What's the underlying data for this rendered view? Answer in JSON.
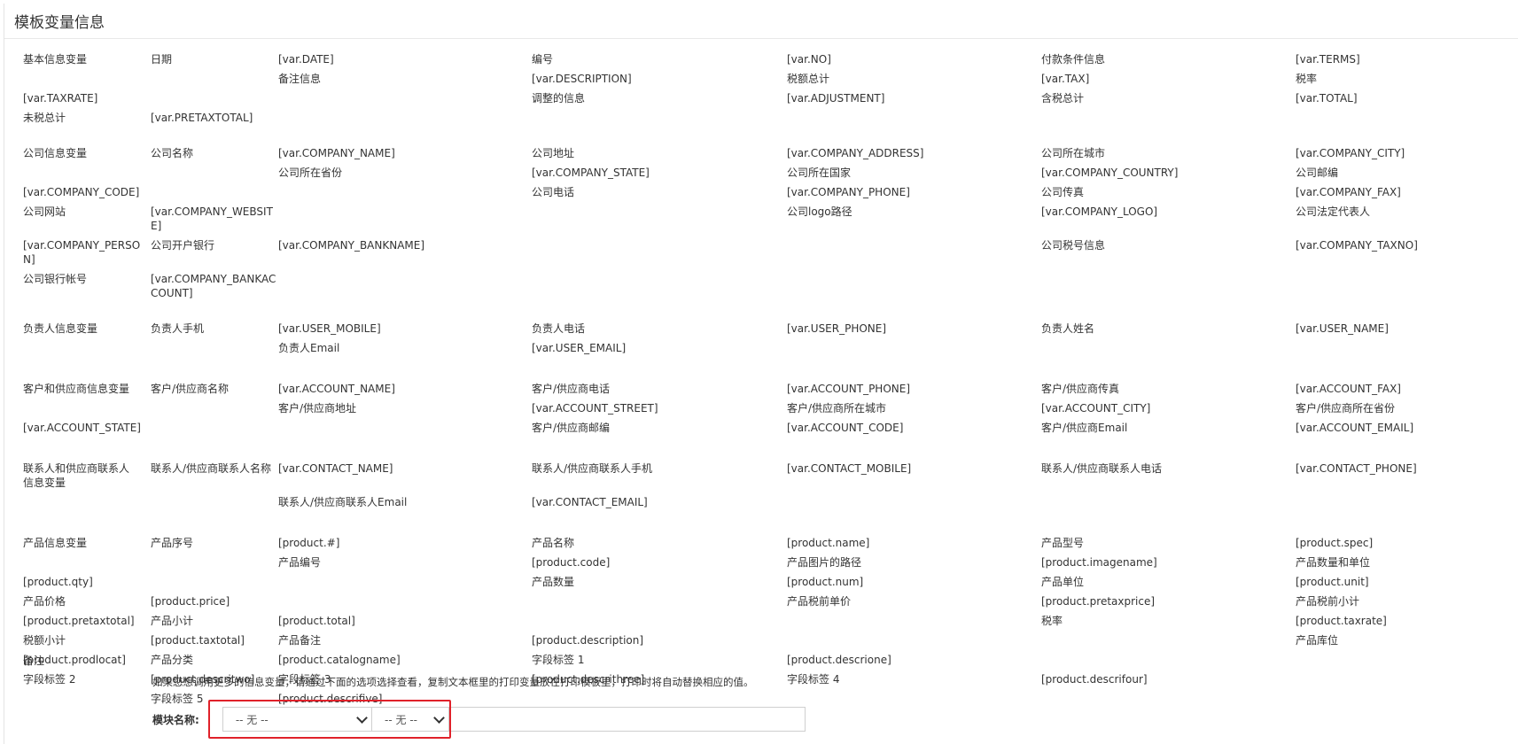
{
  "header": {
    "title": "模板变量信息"
  },
  "groups": [
    {
      "title": "基本信息变量",
      "rows": [
        [
          "日期",
          "[var.DATE]",
          "编号",
          "[var.NO]",
          "付款条件信息",
          "[var.TERMS]"
        ],
        [
          "备注信息",
          "[var.DESCRIPTION]",
          "税额总计",
          "[var.TAX]",
          "税率",
          "[var.TAXRATE]"
        ],
        [
          "调整的信息",
          "[var.ADJUSTMENT]",
          "含税总计",
          "[var.TOTAL]",
          "未税总计",
          "[var.PRETAXTOTAL]"
        ]
      ]
    },
    {
      "title": "公司信息变量",
      "rows": [
        [
          "公司名称",
          "[var.COMPANY_NAME]",
          "公司地址",
          "[var.COMPANY_ADDRESS]",
          "公司所在城市",
          "[var.COMPANY_CITY]"
        ],
        [
          "公司所在省份",
          "[var.COMPANY_STATE]",
          "公司所在国家",
          "[var.COMPANY_COUNTRY]",
          "公司邮编",
          "[var.COMPANY_CODE]"
        ],
        [
          "公司电话",
          "[var.COMPANY_PHONE]",
          "公司传真",
          "[var.COMPANY_FAX]",
          "公司网站",
          "[var.COMPANY_WEBSITE]"
        ],
        [
          "公司logo路径",
          "[var.COMPANY_LOGO]",
          "公司法定代表人",
          "[var.COMPANY_PERSON]",
          "公司开户银行",
          "[var.COMPANY_BANKNAME]"
        ],
        [
          "公司税号信息",
          "[var.COMPANY_TAXNO]",
          "公司银行帐号",
          "[var.COMPANY_BANKACCOUNT]",
          "",
          ""
        ]
      ]
    },
    {
      "title": "负责人信息变量",
      "rows": [
        [
          "负责人手机",
          "[var.USER_MOBILE]",
          "负责人电话",
          "[var.USER_PHONE]",
          "负责人姓名",
          "[var.USER_NAME]"
        ],
        [
          "负责人Email",
          "[var.USER_EMAIL]",
          "",
          "",
          "",
          ""
        ]
      ]
    },
    {
      "title": "客户和供应商信息变量",
      "rows": [
        [
          "客户/供应商名称",
          "[var.ACCOUNT_NAME]",
          "客户/供应商电话",
          "[var.ACCOUNT_PHONE]",
          "客户/供应商传真",
          "[var.ACCOUNT_FAX]"
        ],
        [
          "客户/供应商地址",
          "[var.ACCOUNT_STREET]",
          "客户/供应商所在城市",
          "[var.ACCOUNT_CITY]",
          "客户/供应商所在省份",
          "[var.ACCOUNT_STATE]"
        ],
        [
          "客户/供应商邮编",
          "[var.ACCOUNT_CODE]",
          "客户/供应商Email",
          "[var.ACCOUNT_EMAIL]",
          "",
          ""
        ]
      ]
    },
    {
      "title": "联系人和供应商联系人信息变量",
      "rows": [
        [
          "联系人/供应商联系人名称",
          "[var.CONTACT_NAME]",
          "联系人/供应商联系人手机",
          "[var.CONTACT_MOBILE]",
          "联系人/供应商联系人电话",
          "[var.CONTACT_PHONE]"
        ],
        [
          "联系人/供应商联系人Email",
          "[var.CONTACT_EMAIL]",
          "",
          "",
          "",
          ""
        ]
      ]
    },
    {
      "title": "产品信息变量",
      "rows": [
        [
          "产品序号",
          "[product.#]",
          "产品名称",
          "[product.name]",
          "产品型号",
          "[product.spec]"
        ],
        [
          "产品编号",
          "[product.code]",
          "产品图片的路径",
          "[product.imagename]",
          "产品数量和单位",
          "[product.qty]"
        ],
        [
          "产品数量",
          "[product.num]",
          "产品单位",
          "[product.unit]",
          "产品价格",
          "[product.price]"
        ],
        [
          "产品税前单价",
          "[product.pretaxprice]",
          "产品税前小计",
          "[product.pretaxtotal]",
          "产品小计",
          "[product.total]"
        ],
        [
          "税率",
          "[product.taxrate]",
          "税额小计",
          "[product.taxtotal]",
          "产品备注",
          "[product.description]"
        ],
        [
          "产品库位",
          "[product.prodlocat]",
          "产品分类",
          "[product.catalogname]",
          "字段标签 1",
          "[product.descrione]"
        ],
        [
          "字段标签 2",
          "[product.descritwo]",
          "字段标签 3",
          "[product.descrithree]",
          "字段标签 4",
          "[product.descrifour]"
        ],
        [
          "字段标签 5",
          "[product.descrifive]",
          "",
          "",
          "",
          ""
        ]
      ]
    }
  ],
  "remark": {
    "title": "备注",
    "hint": "如果您想调用更多的信息变量，请通过下面的选项选择查看，复制文本框里的打印变量放在打印模板里，打印时将自动替换相应的值。",
    "module_label": "模块名称:",
    "select_module_value": "-- 无 --",
    "select_field_value": "-- 无 --",
    "output_value": ""
  }
}
